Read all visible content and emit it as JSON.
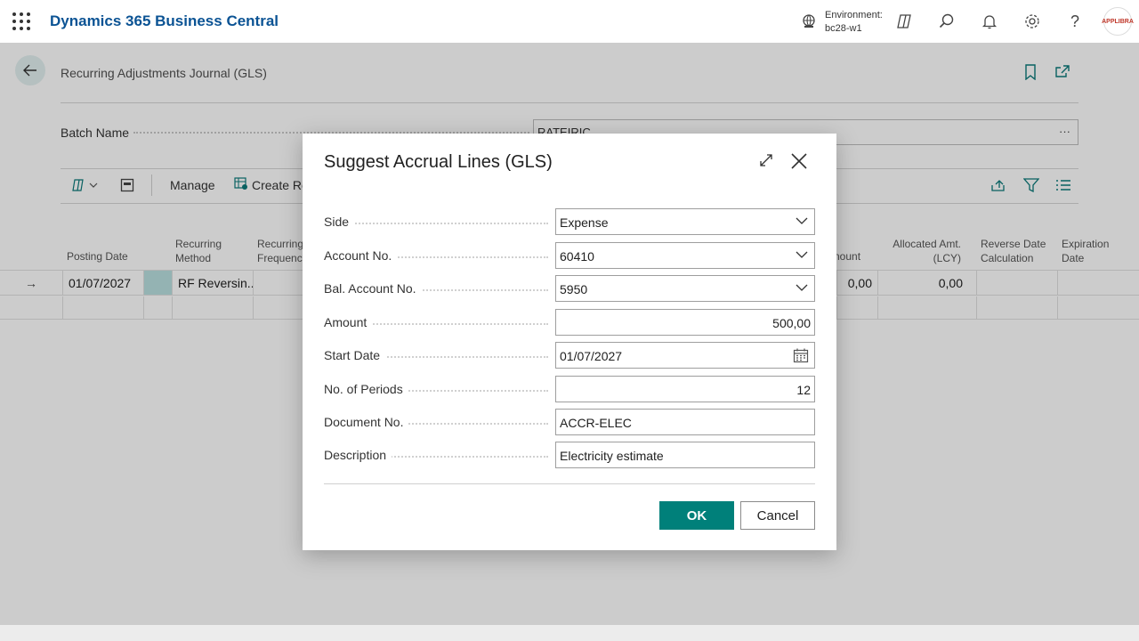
{
  "topbar": {
    "app_title": "Dynamics 365 Business Central",
    "env_label": "Environment:",
    "env_value": "bc28-w1",
    "avatar_text": "APPLIBRA"
  },
  "page": {
    "title": "Recurring Adjustments Journal (GLS)",
    "batch_label": "Batch Name",
    "batch_value": "RATEIRIC",
    "actions": {
      "manage": "Manage",
      "create": "Create Re"
    },
    "columns": {
      "posting_date": "Posting Date",
      "recurring_method_1": "Recurring",
      "recurring_method_2": "Method",
      "recurring_freq_1": "Recurring",
      "recurring_freq_2": "Frequency",
      "amount": "nount",
      "allocated_1": "Allocated Amt.",
      "allocated_2": "(LCY)",
      "reverse_1": "Reverse Date",
      "reverse_2": "Calculation",
      "expiration_1": "Expiration",
      "expiration_2": "Date"
    },
    "row": {
      "arrow": "→",
      "posting_date": "01/07/2027",
      "recurring_method": "RF Reversin...",
      "amount": "0,00",
      "allocated": "0,00"
    }
  },
  "dialog": {
    "title": "Suggest Accrual Lines (GLS)",
    "fields": [
      {
        "label": "Side",
        "value": "Expense"
      },
      {
        "label": "Account No.",
        "value": "60410"
      },
      {
        "label": "Bal. Account No.",
        "value": "5950"
      },
      {
        "label": "Amount",
        "value": "500,00"
      },
      {
        "label": "Start Date",
        "value": "01/07/2027"
      },
      {
        "label": "No. of Periods",
        "value": "12"
      },
      {
        "label": "Document No.",
        "value": "ACCR-ELEC"
      },
      {
        "label": "Description",
        "value": "Electricity estimate"
      }
    ],
    "ok_label": "OK",
    "cancel_label": "Cancel"
  },
  "colors": {
    "brand": "#0b5394",
    "accent": "#00807a"
  }
}
